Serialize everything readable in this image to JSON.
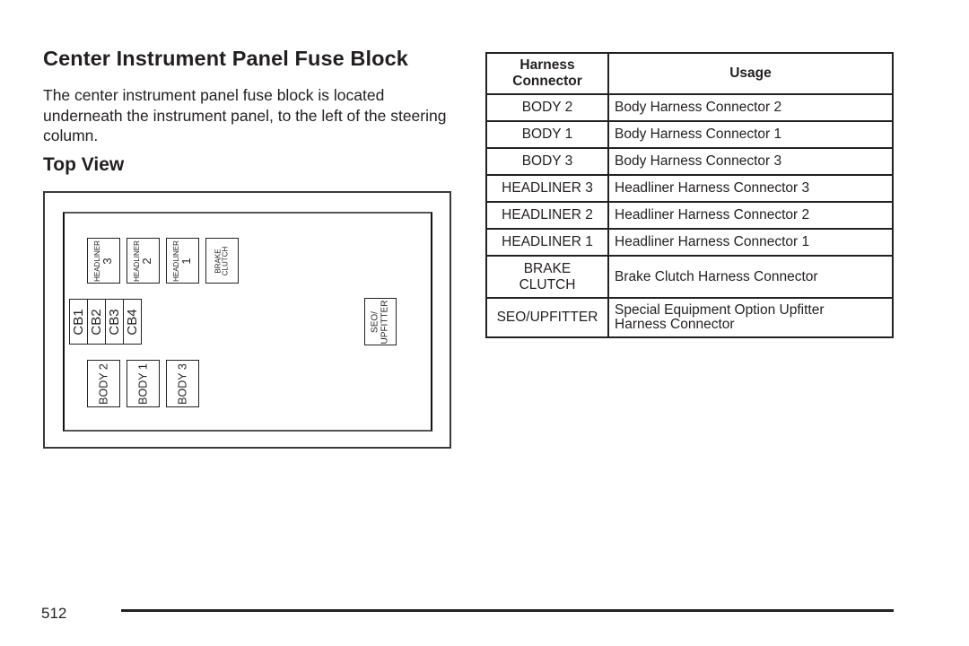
{
  "heading": "Center Instrument Panel Fuse Block",
  "intro": "The center instrument panel fuse block is located underneath the instrument panel, to the left of the steering column.",
  "subheading": "Top View",
  "diagram": {
    "headliners": [
      {
        "label": "HEADLINER",
        "num": "3"
      },
      {
        "label": "HEADLINER",
        "num": "2"
      },
      {
        "label": "HEADLINER",
        "num": "1"
      }
    ],
    "brake_clutch": {
      "line1": "BRAKE",
      "line2": "CLUTCH"
    },
    "circuit_breakers": [
      "CB1",
      "CB2",
      "CB3",
      "CB4"
    ],
    "bodies": [
      "BODY 2",
      "BODY 1",
      "BODY 3"
    ],
    "seo": {
      "line1": "SEO/",
      "line2": "UPFITTER"
    }
  },
  "table": {
    "headers": {
      "connector_line1": "Harness",
      "connector_line2": "Connector",
      "usage": "Usage"
    },
    "rows": [
      {
        "connector": "BODY 2",
        "usage": "Body Harness Connector 2"
      },
      {
        "connector": "BODY 1",
        "usage": "Body Harness Connector 1"
      },
      {
        "connector": "BODY 3",
        "usage": "Body Harness Connector 3"
      },
      {
        "connector": "HEADLINER 3",
        "usage": "Headliner Harness Connector 3"
      },
      {
        "connector": "HEADLINER 2",
        "usage": "Headliner Harness Connector 2"
      },
      {
        "connector": "HEADLINER 1",
        "usage": "Headliner Harness Connector 1"
      },
      {
        "connector_line1": "BRAKE",
        "connector_line2": "CLUTCH",
        "usage": "Brake Clutch Harness Connector"
      },
      {
        "connector": "SEO/UPFITTER",
        "usage_line1": "Special Equipment Option Upfitter",
        "usage_line2": "Harness Connector"
      }
    ]
  },
  "footer": {
    "page_number": "512"
  }
}
